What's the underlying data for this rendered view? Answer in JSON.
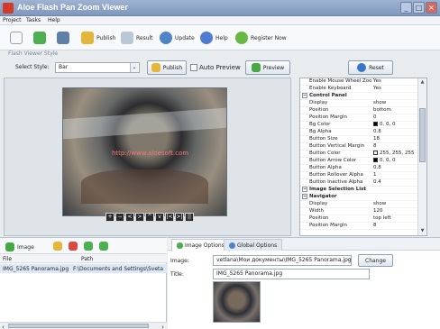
{
  "window": {
    "title": "Aloe Flash Pan Zoom Viewer",
    "minimize": "_",
    "maximize": "□",
    "close": "×"
  },
  "menu": [
    "Project",
    "Tasks",
    "Help"
  ],
  "toolbar": {
    "publish": "Publish",
    "result": "Result",
    "update": "Update",
    "help": "Help",
    "register": "Register Now"
  },
  "section": "Flash Viewer Style",
  "style_controls": {
    "select_label": "Select Style:",
    "selected_style": "Bar",
    "publish": "Publish",
    "auto_preview": "Auto Preview",
    "preview": "Preview",
    "reset": "Reset"
  },
  "preview": {
    "watermark": "http://www.aloesoft.com",
    "nav_buttons": [
      "+",
      "−",
      "<",
      ">",
      "^",
      "v",
      "|<",
      ">|",
      "||"
    ]
  },
  "properties": [
    {
      "name": "Enable Mouse Wheel Zoom",
      "value": "Yes"
    },
    {
      "name": "Enable Keyboard",
      "value": "Yes"
    },
    {
      "name": "Control Panel",
      "value": "",
      "group": true
    },
    {
      "name": "Display",
      "value": "show"
    },
    {
      "name": "Position",
      "value": "bottom"
    },
    {
      "name": "Position Margin",
      "value": "0"
    },
    {
      "name": "Bg Color",
      "value": "0, 0, 0",
      "swatch": "#000000"
    },
    {
      "name": "Bg Alpha",
      "value": "0.8"
    },
    {
      "name": "Button Size",
      "value": "18"
    },
    {
      "name": "Button Vertical Margin",
      "value": "8"
    },
    {
      "name": "Button Color",
      "value": "255, 255, 255",
      "swatch": "#ffffff"
    },
    {
      "name": "Button Arrow Color",
      "value": "0, 0, 0",
      "swatch": "#000000"
    },
    {
      "name": "Button Alpha",
      "value": "0.8"
    },
    {
      "name": "Button Rollover Alpha",
      "value": "1"
    },
    {
      "name": "Button Inactive Alpha",
      "value": "0.4"
    },
    {
      "name": "Image Selection List",
      "value": "",
      "group": true
    },
    {
      "name": "Navigator",
      "value": "",
      "group": true
    },
    {
      "name": "Display",
      "value": "show"
    },
    {
      "name": "Width",
      "value": "120"
    },
    {
      "name": "Position",
      "value": "top left"
    },
    {
      "name": "Position Margin",
      "value": "8"
    }
  ],
  "image_panel": {
    "add_image": "Image",
    "columns": [
      "File",
      "Path"
    ],
    "rows": [
      {
        "file": "IMG_5265 Panorama.jpg",
        "path": "F:\\Documents and Settings\\Sveta"
      }
    ]
  },
  "options": {
    "tabs": [
      "Image Options",
      "Global Options"
    ],
    "image_label": "Image:",
    "image_path": "vetlana\\Мои документы\\IMG_5265 Panorama.jpg",
    "change": "Change",
    "title_label": "Title:",
    "title_value": "IMG_5265 Panorama.jpg"
  }
}
